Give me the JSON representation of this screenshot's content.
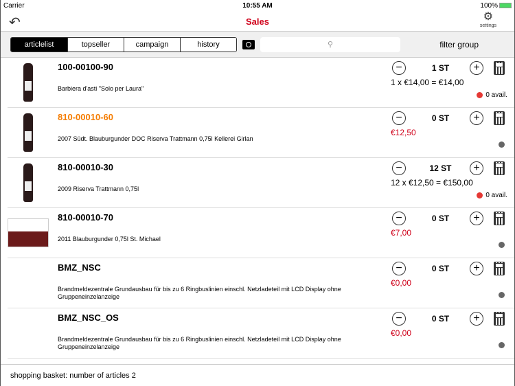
{
  "status": {
    "carrier": "Carrier",
    "time": "10:55 AM",
    "battery": "100%"
  },
  "nav": {
    "title": "Sales",
    "settings": "settings"
  },
  "tabs": [
    "articlelist",
    "topseller",
    "campaign",
    "history"
  ],
  "filter": "filter group",
  "rows": [
    {
      "code": "100-00100-90",
      "desc": "Barbiera d'asti \"Solo per Laura\"",
      "qty": "1 ST",
      "price": "1 x €14,00 = €14,00",
      "price_red": false,
      "avail": "0 avail.",
      "dot": "#e53935",
      "img": "bottle",
      "orange": false
    },
    {
      "code": "810-00010-60",
      "desc": "2007 Südt. Blauburgunder DOC  Riserva Trattmann 0,75l    Kellerei Girlan",
      "qty": "0 ST",
      "price": "€12,50",
      "price_red": true,
      "avail": "",
      "dot": "#666666",
      "img": "bottle",
      "orange": true
    },
    {
      "code": "810-00010-30",
      "desc": "2009  Riserva Trattmann 0,75l",
      "qty": "12 ST",
      "price": "12 x €12,50 = €150,00",
      "price_red": false,
      "avail": "0 avail.",
      "dot": "#e53935",
      "img": "bottle",
      "orange": false
    },
    {
      "code": "810-00010-70",
      "desc": "2011  Blauburgunder 0,75l St. Michael",
      "qty": "0 ST",
      "price": "€7,00",
      "price_red": true,
      "avail": "",
      "dot": "#666666",
      "img": "label",
      "orange": false
    },
    {
      "code": "BMZ_NSC",
      "desc": "Brandmeldezentrale Grundausbau für bis zu 6 Ringbuslinien einschl. Netzladeteil mit LCD Display ohne Gruppeneinzelanzeige",
      "qty": "0 ST",
      "price": "€0,00",
      "price_red": true,
      "avail": "",
      "dot": "#666666",
      "img": "",
      "orange": false
    },
    {
      "code": "BMZ_NSC_OS",
      "desc": "Brandmeldezentrale Grundausbau für bis zu 6 Ringbuslinien einschl. Netzladeteil mit LCD Display ohne Gruppeneinzelanzeige",
      "qty": "0 ST",
      "price": "€0,00",
      "price_red": true,
      "avail": "",
      "dot": "#666666",
      "img": "",
      "orange": false
    }
  ],
  "footer": "shopping basket: number of articles 2"
}
